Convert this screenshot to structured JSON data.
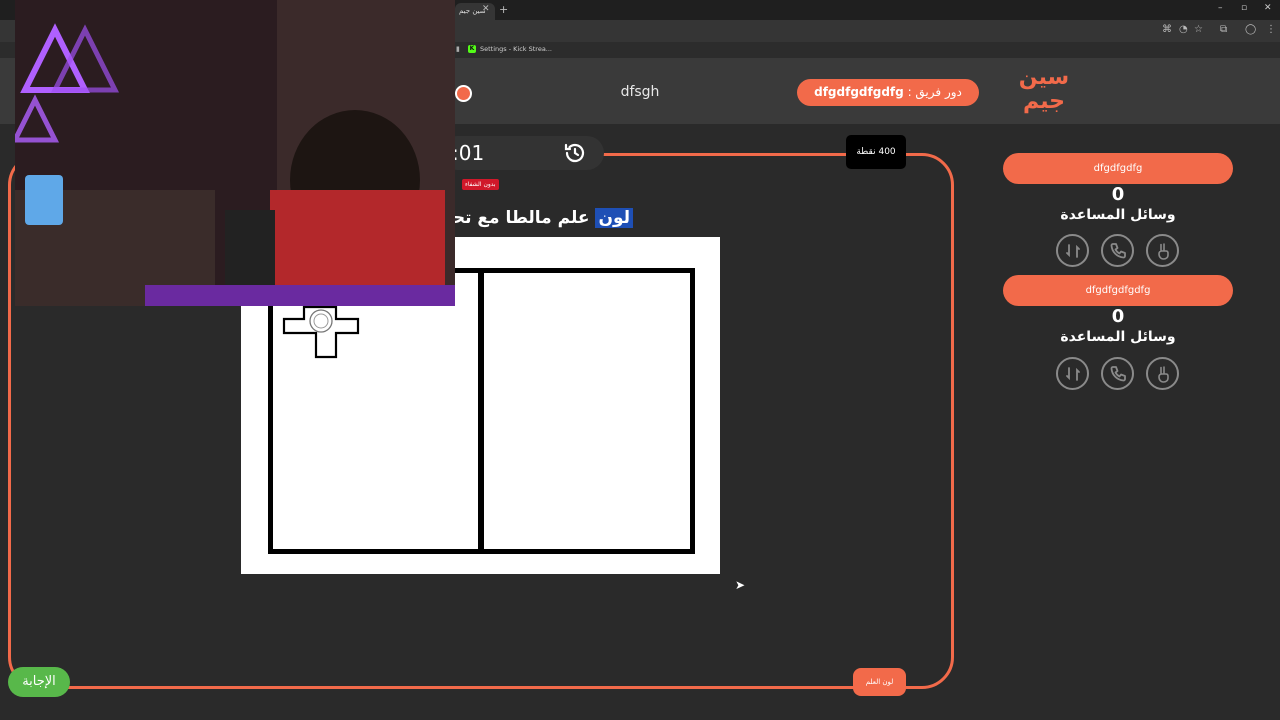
{
  "browser": {
    "active_tab_title": "سين جيم",
    "new_tab_label": "+",
    "bookmark_label": "Settings - Kick Strea..."
  },
  "header": {
    "logo_text": "سين جيم",
    "turn_label": "دور فريق :",
    "turn_team": "dfgdfgdfgdfg",
    "question_name": "dfsgh"
  },
  "game": {
    "timer": ":01",
    "points_label": "400 نقطة",
    "no_hint_badge": "بدون الشفاء",
    "question_highlight": "لون",
    "question_rest": "علم مالطا مع تحد",
    "answer_button": "الإجابة",
    "color_flag_button": "لون العلم"
  },
  "teams": [
    {
      "name": "dfgdfgdfg",
      "score": "0",
      "helpers_label": "وسائل المساعدة"
    },
    {
      "name": "dfgdfgdfgdfg",
      "score": "0",
      "helpers_label": "وسائل المساعدة"
    }
  ],
  "helper_icons": [
    "swap-icon",
    "phone-icon",
    "peace-hand-icon"
  ],
  "colors": {
    "accent": "#f26a4a",
    "background": "#2a2a2a",
    "header": "#3a3a3a",
    "answer_green": "#58b84a",
    "highlight_blue": "#1e4fb5",
    "badge_red": "#d0182a"
  }
}
